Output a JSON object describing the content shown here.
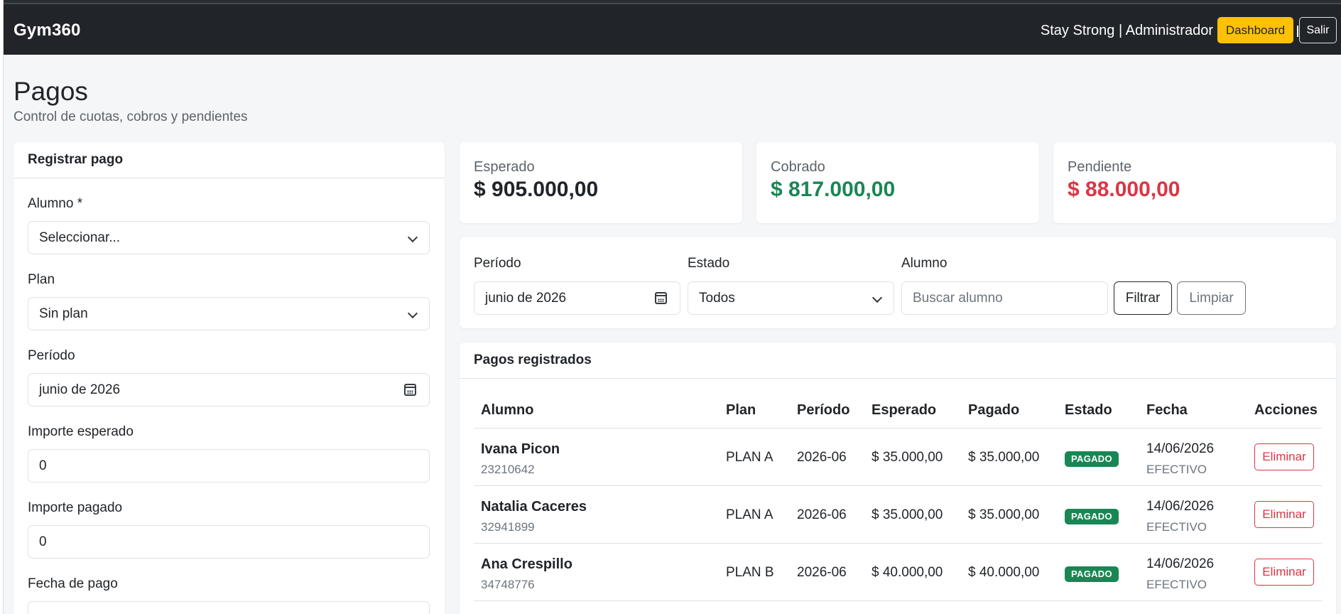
{
  "navbar": {
    "brand": "Gym360",
    "user_text": "Stay Strong | Administrador",
    "dashboard_label": "Dashboard",
    "salir_label": "Salir"
  },
  "page": {
    "title": "Pagos",
    "subtitle": "Control de cuotas, cobros y pendientes"
  },
  "form": {
    "header": "Registrar pago",
    "alumno_label": "Alumno *",
    "alumno_value": "Seleccionar...",
    "plan_label": "Plan",
    "plan_value": "Sin plan",
    "periodo_label": "Período",
    "periodo_value": "junio de 2026",
    "esperado_label": "Importe esperado",
    "esperado_value": "0",
    "pagado_label": "Importe pagado",
    "pagado_value": "0",
    "fecha_label": "Fecha de pago"
  },
  "stats": {
    "esperado": {
      "label": "Esperado",
      "value": "$ 905.000,00",
      "color": "#212529"
    },
    "cobrado": {
      "label": "Cobrado",
      "value": "$ 817.000,00",
      "color": "#198754"
    },
    "pendiente": {
      "label": "Pendiente",
      "value": "$ 88.000,00",
      "color": "#dc3545"
    }
  },
  "filters": {
    "periodo_label": "Período",
    "periodo_value": "junio de 2026",
    "estado_label": "Estado",
    "estado_value": "Todos",
    "alumno_label": "Alumno",
    "alumno_placeholder": "Buscar alumno",
    "filtrar_label": "Filtrar",
    "limpiar_label": "Limpiar"
  },
  "table": {
    "header": "Pagos registrados",
    "columns": [
      "Alumno",
      "Plan",
      "Período",
      "Esperado",
      "Pagado",
      "Estado",
      "Fecha",
      "Acciones"
    ],
    "rows": [
      {
        "name": "Ivana Picon",
        "dni": "23210642",
        "plan": "PLAN A",
        "periodo": "2026-06",
        "esperado": "$ 35.000,00",
        "pagado": "$ 35.000,00",
        "estado": "PAGADO",
        "fecha": "14/06/2026",
        "metodo": "EFECTIVO",
        "accion": "Eliminar"
      },
      {
        "name": "Natalia Caceres",
        "dni": "32941899",
        "plan": "PLAN A",
        "periodo": "2026-06",
        "esperado": "$ 35.000,00",
        "pagado": "$ 35.000,00",
        "estado": "PAGADO",
        "fecha": "14/06/2026",
        "metodo": "EFECTIVO",
        "accion": "Eliminar"
      },
      {
        "name": "Ana Crespillo",
        "dni": "34748776",
        "plan": "PLAN B",
        "periodo": "2026-06",
        "esperado": "$ 40.000,00",
        "pagado": "$ 40.000,00",
        "estado": "PAGADO",
        "fecha": "14/06/2026",
        "metodo": "EFECTIVO",
        "accion": "Eliminar"
      }
    ]
  }
}
